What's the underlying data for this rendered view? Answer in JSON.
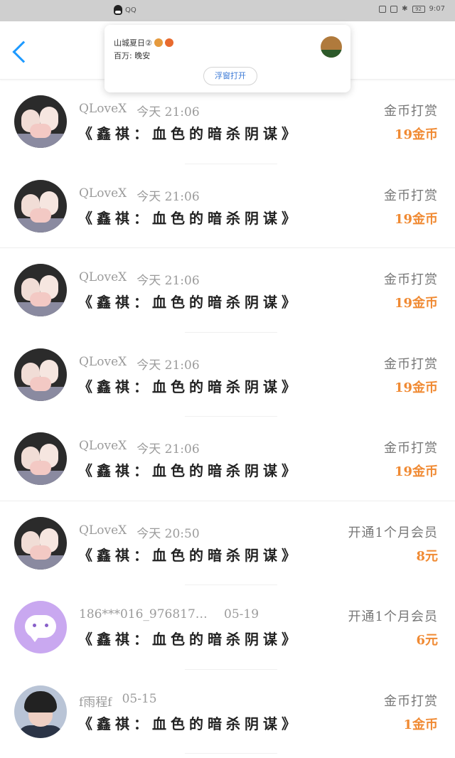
{
  "status_bar": {
    "app_name": "QQ",
    "time": "9:07",
    "battery": "92"
  },
  "notification": {
    "group_name": "山城夏日②",
    "message": "百万: 晚安",
    "button_label": "浮窗打开"
  },
  "colors": {
    "accent": "#1e9aff",
    "amount": "#f08a33",
    "meta": "#9b9b9b"
  },
  "records": [
    {
      "name": "QLoveX",
      "time": "今天 21:06",
      "title": "《鑫祺：血色的暗杀阴谋》",
      "type": "金币打赏",
      "amount": "19金币",
      "avatar": "couple"
    },
    {
      "name": "QLoveX",
      "time": "今天 21:06",
      "title": "《鑫祺：血色的暗杀阴谋》",
      "type": "金币打赏",
      "amount": "19金币",
      "avatar": "couple"
    },
    {
      "name": "QLoveX",
      "time": "今天 21:06",
      "title": "《鑫祺：血色的暗杀阴谋》",
      "type": "金币打赏",
      "amount": "19金币",
      "avatar": "couple"
    },
    {
      "name": "QLoveX",
      "time": "今天 21:06",
      "title": "《鑫祺：血色的暗杀阴谋》",
      "type": "金币打赏",
      "amount": "19金币",
      "avatar": "couple"
    },
    {
      "name": "QLoveX",
      "time": "今天 21:06",
      "title": "《鑫祺：血色的暗杀阴谋》",
      "type": "金币打赏",
      "amount": "19金币",
      "avatar": "couple"
    },
    {
      "name": "QLoveX",
      "time": "今天 20:50",
      "title": "《鑫祺：血色的暗杀阴谋》",
      "type": "开通1个月会员",
      "amount": "8元",
      "avatar": "couple"
    },
    {
      "name": "186***016_9768178…",
      "time": "05-19",
      "title": "《鑫祺：血色的暗杀阴谋》",
      "type": "开通1个月会员",
      "amount": "6元",
      "avatar": "chat-bubble"
    },
    {
      "name": "f雨程f",
      "time": "05-15",
      "title": "《鑫祺：血色的暗杀阴谋》",
      "type": "金币打赏",
      "amount": "1金币",
      "avatar": "photo"
    }
  ]
}
